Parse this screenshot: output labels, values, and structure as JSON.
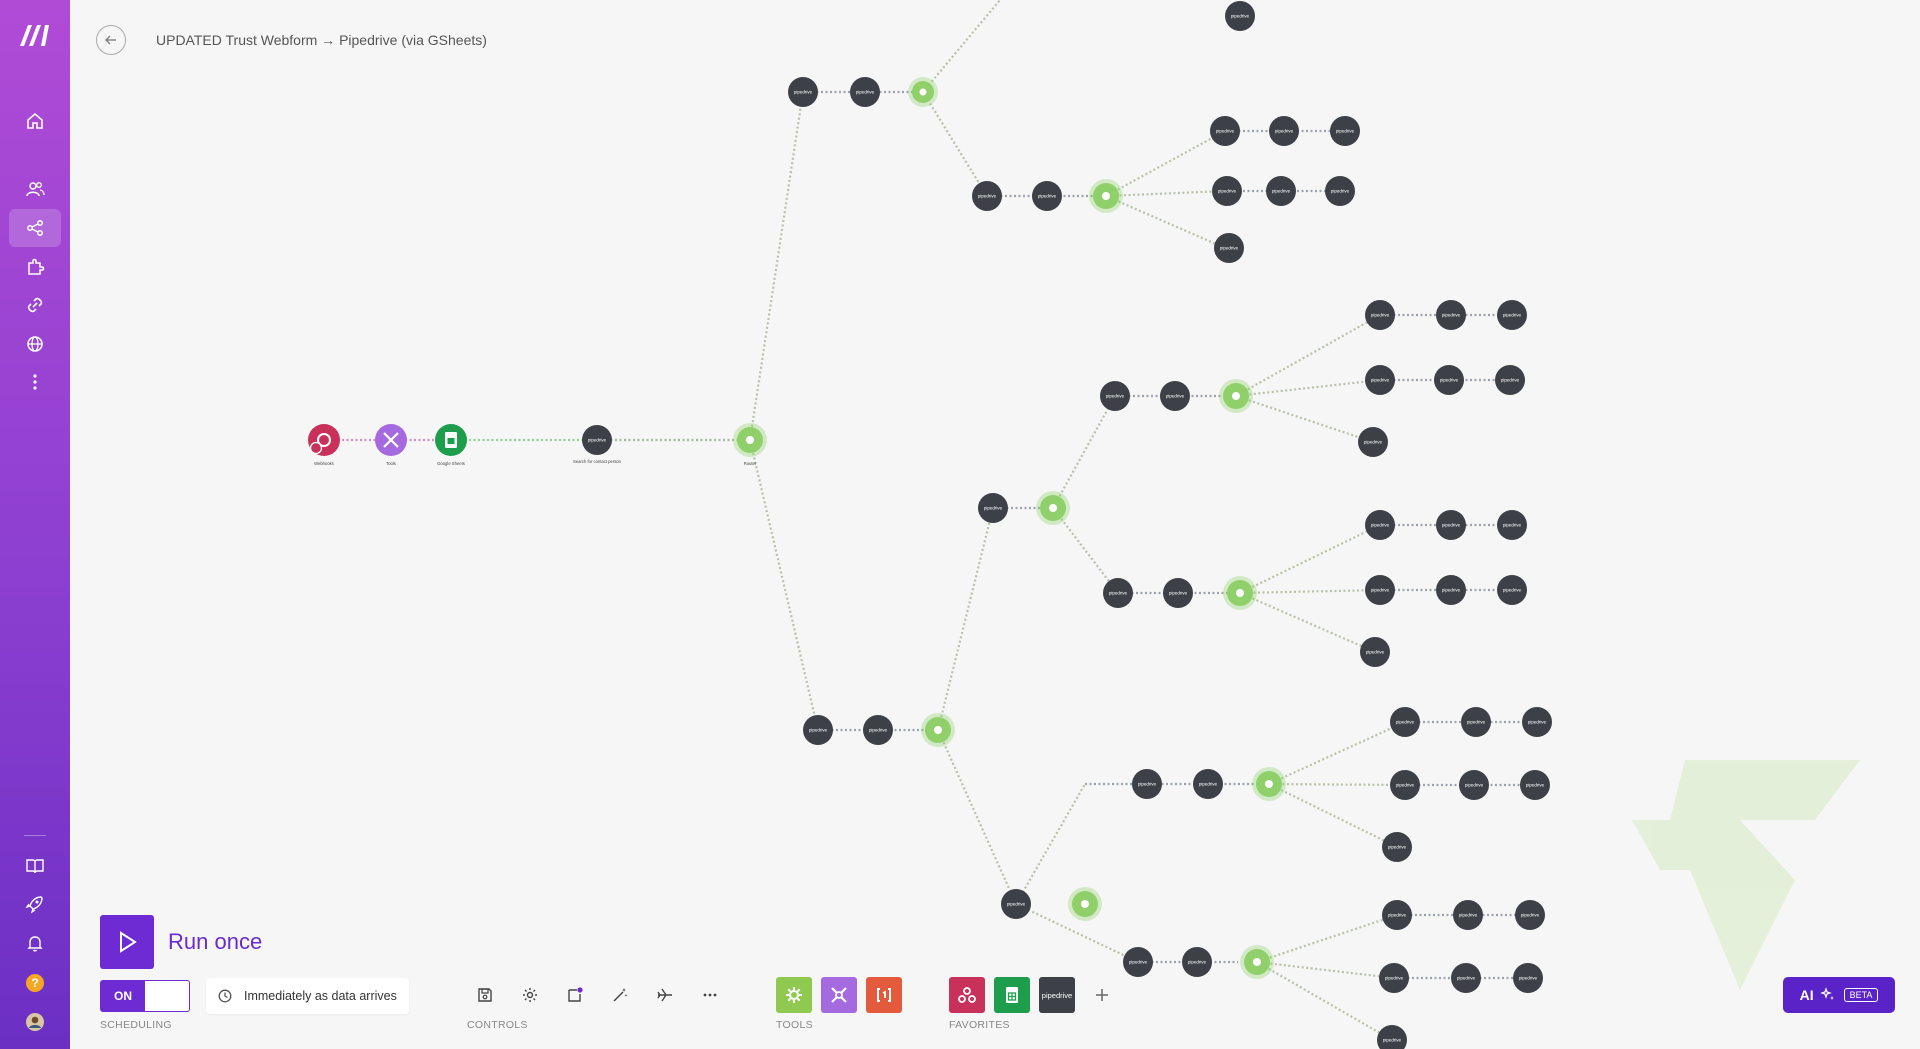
{
  "app": {
    "breadcrumb": "UPDATED Trust Webform → Pipedrive (via GSheets)"
  },
  "sidebar": {
    "items": [
      {
        "name": "home-icon"
      },
      {
        "name": "team-icon"
      },
      {
        "name": "scenarios-icon"
      },
      {
        "name": "apps-icon"
      },
      {
        "name": "connections-icon"
      },
      {
        "name": "webhooks-icon"
      },
      {
        "name": "more-icon"
      },
      {
        "name": "docs-icon"
      },
      {
        "name": "launch-icon"
      },
      {
        "name": "notifications-icon"
      },
      {
        "name": "help-icon"
      },
      {
        "name": "avatar"
      }
    ]
  },
  "run": {
    "label": "Run once"
  },
  "scheduling": {
    "toggle_on": "ON",
    "schedule": "Immediately as data arrives",
    "section_label": "SCHEDULING"
  },
  "controls": {
    "section_label": "CONTROLS",
    "items": [
      "save-icon",
      "settings-icon",
      "notes-icon",
      "auto-align-icon",
      "explain-flow-icon",
      "more-icon"
    ]
  },
  "tools": {
    "section_label": "TOOLS",
    "items": [
      "tools-gear-icon",
      "flow-control-icon",
      "text-parser-icon"
    ]
  },
  "favorites": {
    "section_label": "FAVORITES",
    "items": [
      "webhooks-icon",
      "google-sheets-icon",
      "pipedrive-icon",
      "add-favorite-icon"
    ],
    "pipedrive_text": "pipedrive"
  },
  "ai_button": {
    "label": "AI",
    "badge": "BETA"
  },
  "colors": {
    "accent": "#6e2bd4",
    "router_green": "#8fd06a",
    "node_dark": "#3d4147",
    "webhook_red": "#c8315a",
    "tools_purple": "#a56ae0",
    "sheets_green": "#1e9e4d"
  },
  "scenario": {
    "nodes": [
      {
        "type": "webhook",
        "label": "Webhooks"
      },
      {
        "type": "tools",
        "label": "Tools"
      },
      {
        "type": "sheets",
        "label": "Google Sheets"
      },
      {
        "type": "pipedrive",
        "label": "Search for contact person"
      },
      {
        "type": "router",
        "label": "Router"
      }
    ]
  }
}
